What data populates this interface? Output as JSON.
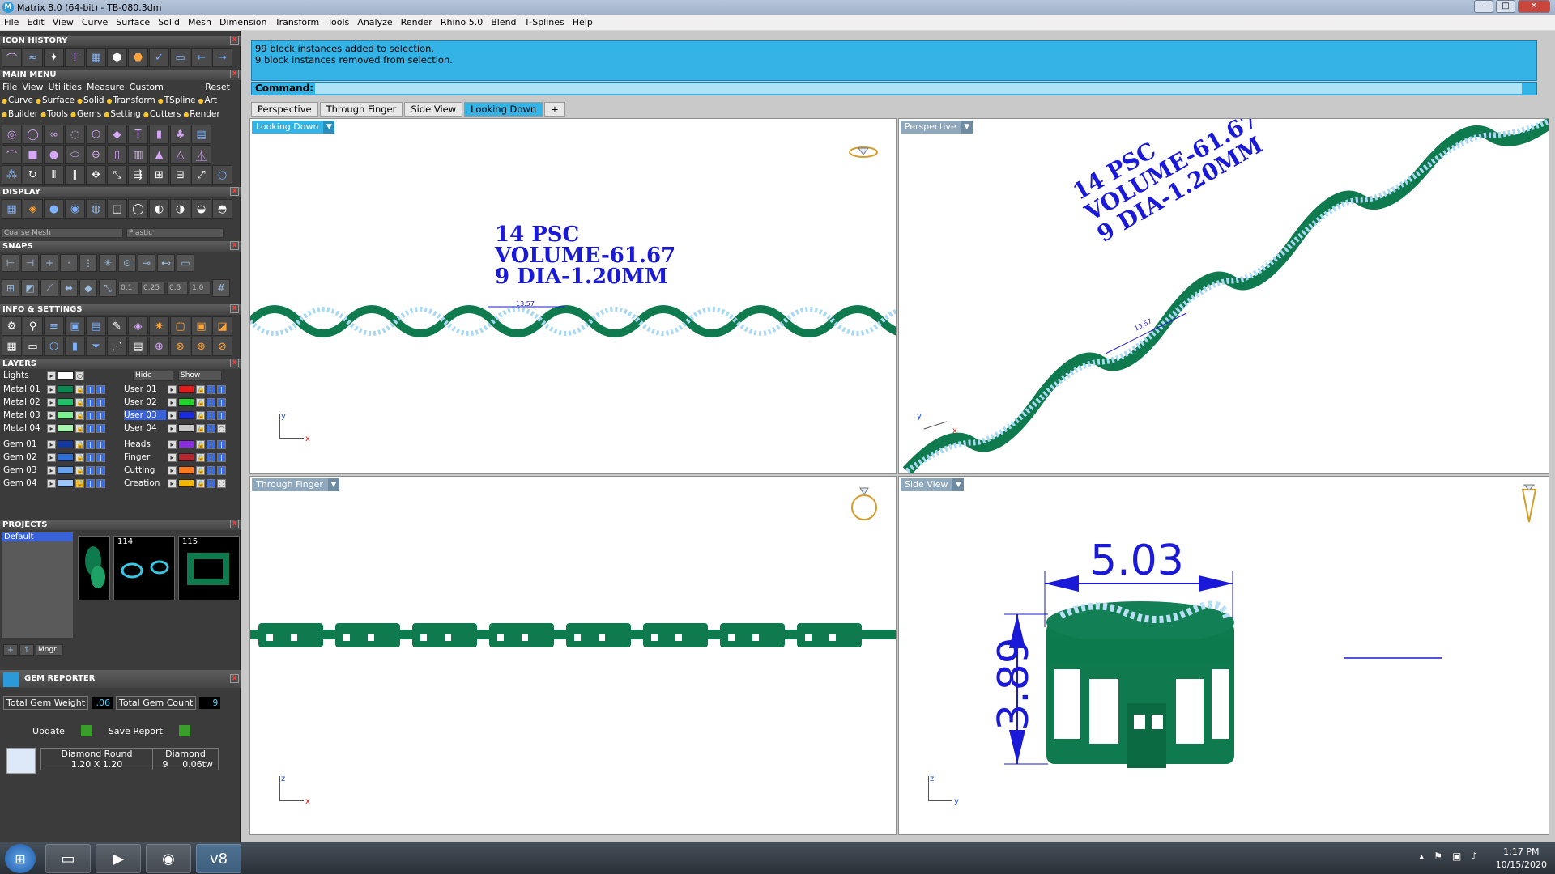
{
  "window": {
    "title": "Matrix 8.0 (64-bit) - TB-080.3dm",
    "btn_min": "–",
    "btn_max": "□",
    "btn_close": "✕"
  },
  "menubar": [
    "File",
    "Edit",
    "View",
    "Curve",
    "Surface",
    "Solid",
    "Mesh",
    "Dimension",
    "Transform",
    "Tools",
    "Analyze",
    "Render",
    "Rhino 5.0",
    "Blend",
    "T-Splines",
    "Help"
  ],
  "left": {
    "icon_history": "ICON HISTORY",
    "main_menu": "MAIN MENU",
    "mm_menu": [
      "File",
      "View",
      "Utilities",
      "Measure",
      "Custom"
    ],
    "reset": "Reset",
    "mm_tabs_row1": [
      "Curve",
      "Surface",
      "Solid",
      "Transform",
      "TSpline",
      "Art"
    ],
    "mm_tabs_row2": [
      "Builder",
      "Tools",
      "Gems",
      "Setting",
      "Cutters",
      "Render"
    ],
    "display": "DISPLAY",
    "display_mesh": "Coarse Mesh",
    "display_mat": "Plastic",
    "snaps": "SNAPS",
    "snap_values": [
      "0.1",
      "0.25",
      "0.5",
      "1.0"
    ],
    "info": "INFO & SETTINGS",
    "layers": "LAYERS",
    "lights": "Lights",
    "hide": "Hide",
    "show": "Show",
    "layers_left": [
      {
        "name": "Metal 01",
        "color": "#0a8a52"
      },
      {
        "name": "Metal 02",
        "color": "#1fbf6a"
      },
      {
        "name": "Metal 03",
        "color": "#7df090"
      },
      {
        "name": "Metal 04",
        "color": "#a8f5b0"
      },
      {
        "name": "Gem 01",
        "color": "#1437a0"
      },
      {
        "name": "Gem 02",
        "color": "#2f6fd8"
      },
      {
        "name": "Gem 03",
        "color": "#6aa4f0"
      },
      {
        "name": "Gem 04",
        "color": "#9cc6ff"
      }
    ],
    "layers_right": [
      {
        "name": "User 01",
        "color": "#e31b1b"
      },
      {
        "name": "User 02",
        "color": "#21d62a"
      },
      {
        "name": "User 03",
        "color": "#1a2ce0"
      },
      {
        "name": "User 04",
        "color": "#c9c9c9"
      },
      {
        "name": "Heads",
        "color": "#8b2be2"
      },
      {
        "name": "Finger",
        "color": "#b8262f"
      },
      {
        "name": "Cutting",
        "color": "#ff7a1a"
      },
      {
        "name": "Creation",
        "color": "#f4b400"
      }
    ],
    "projects": "PROJECTS",
    "project_default": "Default",
    "thumb_labels": [
      "114",
      "115"
    ],
    "mngr": "Mngr",
    "gem_reporter": "GEM REPORTER",
    "total_gem_weight_label": "Total Gem Weight",
    "total_gem_weight": ".06",
    "total_gem_count_label": "Total Gem Count",
    "total_gem_count": "9",
    "update": "Update",
    "save_report": "Save Report",
    "gem_cut": "Diamond Round",
    "gem_type": "Diamond",
    "gem_size": "1.20 X 1.20",
    "gem_qty": "9",
    "gem_wt": "0.06tw"
  },
  "command": {
    "line1": "99 block instances added to selection.",
    "line2": "9 block instances removed from selection.",
    "label": "Command:"
  },
  "vptabs": [
    "Perspective",
    "Through Finger",
    "Side View",
    "Looking Down",
    "+"
  ],
  "viewports": {
    "tl": "Looking Down",
    "tr": "Perspective",
    "bl": "Through Finger",
    "br": "Side View"
  },
  "annot": {
    "l1": "14 PSC",
    "l2": "VOLUME-61.67",
    "l3": "9 DIA-1.20MM",
    "dim_small": "13.57",
    "dim_w": "5.03",
    "dim_h": "3.89"
  },
  "axes": {
    "y": "y",
    "x": "x",
    "z": "z"
  },
  "taskbar": {
    "time": "1:17 PM",
    "date": "10/15/2020"
  },
  "colors": {
    "accent": "#34b3e6",
    "chain": "#0f7a4d",
    "gem": "#a9d9f2",
    "dim": "#1a19d8"
  }
}
